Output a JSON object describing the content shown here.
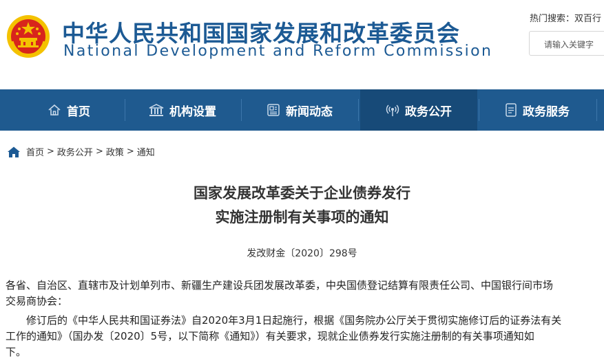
{
  "header": {
    "title_cn": "中华人民共和国国家发展和改革委员会",
    "title_en": "National Development and Reform Commission",
    "hot_search_label": "热门搜索：",
    "hot_search_link": "双百行",
    "search_placeholder": "请输入关键字"
  },
  "nav": {
    "items": [
      {
        "label": "首页",
        "icon": "home-icon"
      },
      {
        "label": "机构设置",
        "icon": "building-icon"
      },
      {
        "label": "新闻动态",
        "icon": "newspaper-icon"
      },
      {
        "label": "政务公开",
        "icon": "broadcast-icon",
        "active": true
      },
      {
        "label": "政务服务",
        "icon": "document-icon"
      }
    ]
  },
  "breadcrumb": {
    "items": [
      "首页",
      "政务公开",
      "政策",
      "通知"
    ],
    "separator": ">"
  },
  "article": {
    "title_line1": "国家发展改革委关于企业债券发行",
    "title_line2": "实施注册制有关事项的通知",
    "doc_number": "发改财金〔2020〕298号",
    "para1_line1": "各省、自治区、直辖市及计划单列市、新疆生产建设兵团发展改革委，中央国债登记结算有限责任公司、中国银行间市场",
    "para1_line2": "交易商协会：",
    "para2_line1": "　　修订后的《中华人民共和国证券法》自2020年3月1日起施行，根据《国务院办公厅关于贯彻实施修订后的证券法有关",
    "para2_line2": "工作的通知》（国办发〔2020〕5号，以下简称《通知》）有关要求，现就企业债券发行实施注册制的有关事项通知如",
    "para2_line3": "下。"
  },
  "colors": {
    "brand_blue": "#1c5a94",
    "nav_bg": "#1f5a8f",
    "nav_active_bg": "#174a78",
    "emblem_red": "#d8251c",
    "emblem_gold": "#f4c200"
  }
}
